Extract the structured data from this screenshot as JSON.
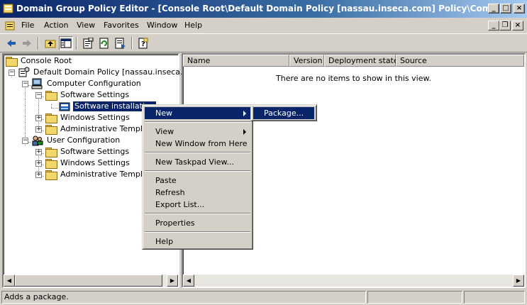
{
  "window": {
    "title": "Domain Group Policy Editor - [Console Root\\Default Domain Policy [nassau.inseca.com] Policy\\Computer Configurati...",
    "min_label": "_",
    "max_label": "□",
    "close_label": "×"
  },
  "menu": {
    "items": [
      "File",
      "Action",
      "View",
      "Favorites",
      "Window",
      "Help"
    ]
  },
  "tree": {
    "root": "Console Root",
    "policy": "Default Domain Policy [nassau.inseca.com]",
    "computer_config": "Computer Configuration",
    "cc_software_settings": "Software Settings",
    "cc_software_installation": "Software installation",
    "cc_windows_settings": "Windows Settings",
    "cc_admin_templates": "Administrative Templates",
    "user_config": "User Configuration",
    "uc_software_settings": "Software Settings",
    "uc_windows_settings": "Windows Settings",
    "uc_admin_templates": "Administrative Templates"
  },
  "list": {
    "columns": [
      "Name",
      "Version",
      "Deployment state",
      "Source"
    ],
    "empty_message": "There are no items to show in this view."
  },
  "context_menu": {
    "items": [
      "New",
      "View",
      "New Window from Here",
      "New Taskpad View...",
      "Paste",
      "Refresh",
      "Export List...",
      "Properties",
      "Help"
    ],
    "highlighted": "New"
  },
  "submenu": {
    "items": [
      "Package..."
    ]
  },
  "status": {
    "text": "Adds a package."
  },
  "colors": {
    "title_gradient_start": "#0a246a",
    "highlight": "#0a246a",
    "chrome": "#d4d0c8"
  }
}
